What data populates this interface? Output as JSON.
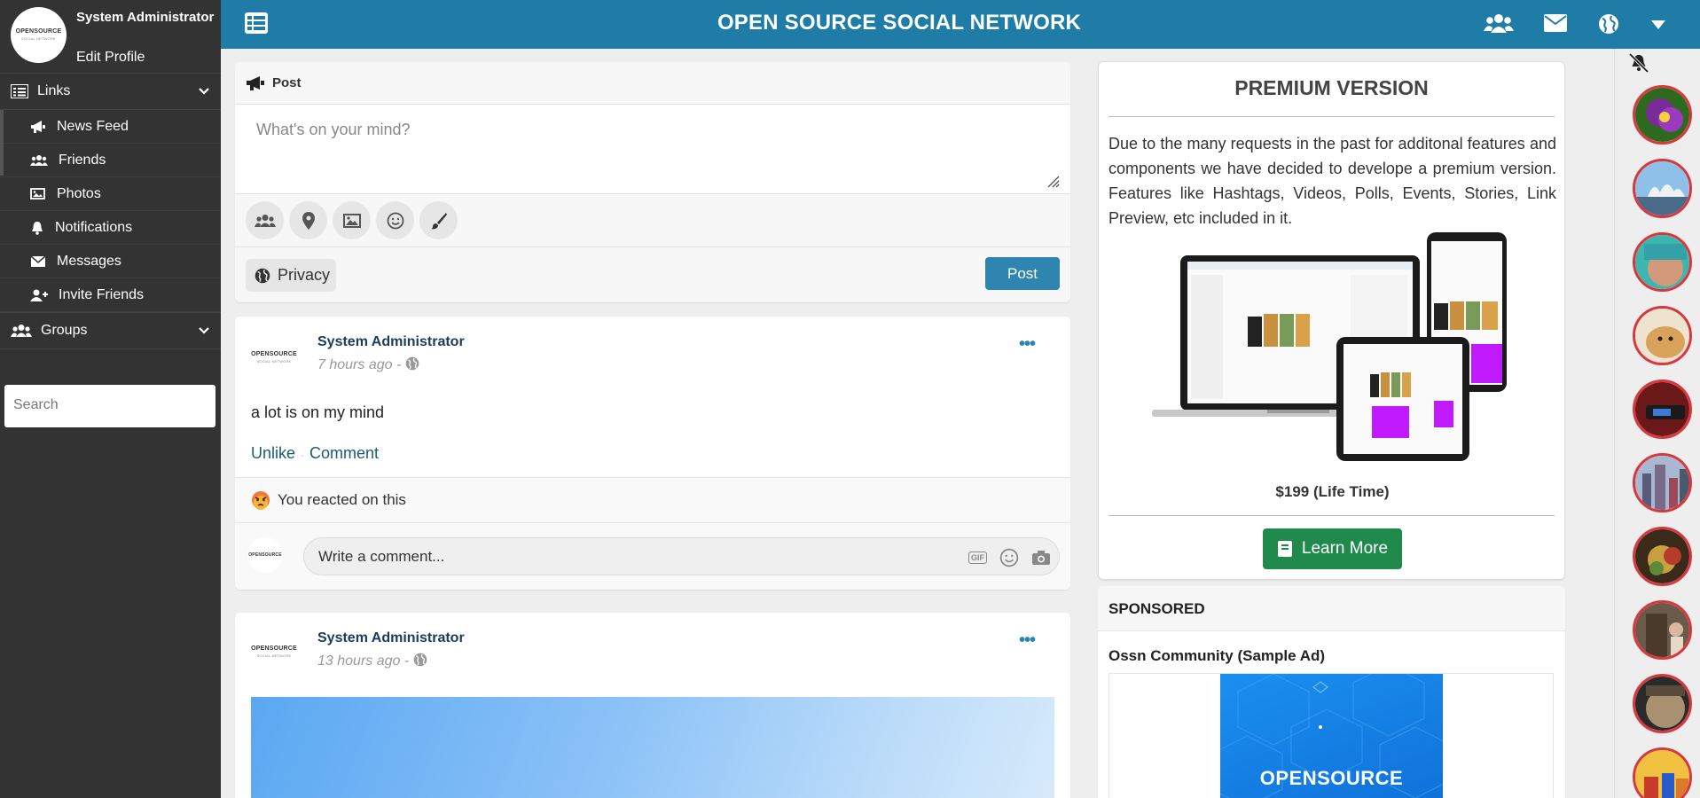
{
  "app": {
    "title": "OPEN SOURCE SOCIAL NETWORK",
    "logo_text": "OPENSOURCE",
    "logo_sub": "SOCIAL NETWORK"
  },
  "sidebar": {
    "user_name": "System Administrator",
    "edit_profile": "Edit Profile",
    "links_label": "Links",
    "items": [
      {
        "label": "News Feed",
        "icon": "bullhorn-icon"
      },
      {
        "label": "Friends",
        "icon": "users-icon"
      },
      {
        "label": "Photos",
        "icon": "image-icon"
      },
      {
        "label": "Notifications",
        "icon": "bell-icon"
      },
      {
        "label": "Messages",
        "icon": "envelope-icon"
      },
      {
        "label": "Invite Friends",
        "icon": "user-plus-icon"
      }
    ],
    "groups_label": "Groups",
    "search_placeholder": "Search"
  },
  "composer": {
    "header": "Post",
    "placeholder": "What's on your mind?",
    "privacy_label": "Privacy",
    "post_label": "Post"
  },
  "posts": [
    {
      "author": "System Administrator",
      "time": "7 hours ago - ",
      "text": "a lot is on my mind",
      "unlike": "Unlike",
      "comment": "Comment",
      "reaction": "You reacted on this",
      "comment_placeholder": "Write a comment...",
      "gif": "GIF"
    },
    {
      "author": "System Administrator",
      "time": "13 hours ago - "
    }
  ],
  "premium": {
    "title": "PREMIUM VERSION",
    "description": "Due to the many requests in the past for additonal features and components we have decided to develope a premium version. Features like Hashtags, Videos, Polls, Events, Stories, Link Preview, etc included in it.",
    "price": "$199 (Life Time)",
    "button": "Learn More"
  },
  "sponsored": {
    "header": "SPONSORED",
    "title": "Ossn Community (Sample Ad)",
    "brand": "OPENSOURCE"
  },
  "colors": {
    "topbar": "#1e7ca6",
    "sidebar": "#333333",
    "accent": "#2e86b0",
    "learn_more": "#1f8a4c",
    "chat_border": "#d9363e"
  }
}
